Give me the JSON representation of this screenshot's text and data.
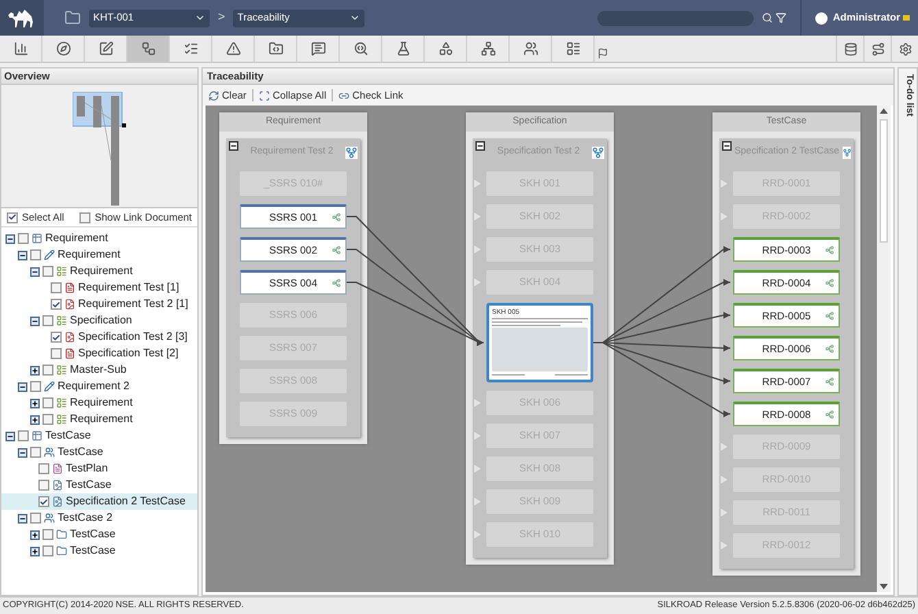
{
  "topbar": {
    "project": "KHT-001",
    "separator": ">",
    "view": "Traceability",
    "user": "Administrator"
  },
  "toolbar": [
    {
      "selected": false
    },
    {
      "selected": false
    },
    {
      "selected": false
    },
    {
      "selected": true
    },
    {
      "selected": false
    },
    {
      "selected": false
    },
    {
      "selected": false
    },
    {
      "selected": false
    },
    {
      "selected": false
    },
    {
      "selected": false
    },
    {
      "selected": false
    },
    {
      "selected": false
    },
    {
      "selected": false
    },
    {
      "selected": false
    }
  ],
  "left_panel": {
    "overview_title": "Overview",
    "select_all": {
      "label": "Select All",
      "checked": true
    },
    "show_link_document": {
      "label": "Show Link Document",
      "checked": false
    },
    "tree": [
      {
        "label": "Requirement",
        "kind": "category",
        "checked": false,
        "expanded": true,
        "selected": false,
        "children": [
          {
            "label": "Requirement",
            "kind": "pencil",
            "checked": false,
            "expanded": true,
            "selected": false,
            "children": [
              {
                "label": "Requirement",
                "kind": "grid",
                "checked": false,
                "expanded": true,
                "selected": false,
                "children": [
                  {
                    "label": "Requirement Test [1]",
                    "kind": "pdf",
                    "checked": false,
                    "selected": false
                  },
                  {
                    "label": "Requirement Test 2 [1]",
                    "kind": "pdf-doc",
                    "checked": true,
                    "selected": false
                  }
                ]
              },
              {
                "label": "Specification",
                "kind": "grid",
                "checked": false,
                "expanded": true,
                "selected": false,
                "children": [
                  {
                    "label": "Specification Test 2 [3]",
                    "kind": "pdf-doc",
                    "checked": true,
                    "selected": false
                  },
                  {
                    "label": "Specification Test [2]",
                    "kind": "pdf",
                    "checked": false,
                    "selected": false
                  }
                ]
              },
              {
                "label": "Master-Sub",
                "kind": "grid",
                "checked": false,
                "expanded": false,
                "selected": false
              }
            ]
          },
          {
            "label": "Requirement 2",
            "kind": "pencil",
            "checked": false,
            "expanded": true,
            "selected": false,
            "children": [
              {
                "label": "Requirement",
                "kind": "grid",
                "checked": false,
                "expanded": false,
                "selected": false
              },
              {
                "label": "Requirement",
                "kind": "grid",
                "checked": false,
                "expanded": false,
                "selected": false
              }
            ]
          }
        ]
      },
      {
        "label": "TestCase",
        "kind": "category",
        "checked": false,
        "expanded": true,
        "selected": false,
        "children": [
          {
            "label": "TestCase",
            "kind": "people",
            "checked": false,
            "expanded": true,
            "selected": false,
            "children": [
              {
                "label": "TestPlan",
                "kind": "plan",
                "checked": false,
                "selected": false
              },
              {
                "label": "TestCase",
                "kind": "testdoc",
                "checked": false,
                "selected": false
              },
              {
                "label": "Specification 2 TestCase",
                "kind": "testdoc",
                "checked": true,
                "selected": true
              }
            ]
          },
          {
            "label": "TestCase 2",
            "kind": "people",
            "checked": false,
            "expanded": true,
            "selected": false,
            "children": [
              {
                "label": "TestCase",
                "kind": "folder",
                "checked": false,
                "expanded": false,
                "selected": false
              },
              {
                "label": "TestCase",
                "kind": "folder",
                "checked": false,
                "expanded": false,
                "selected": false
              }
            ]
          }
        ]
      }
    ]
  },
  "traceability": {
    "title": "Traceability",
    "actions": [
      {
        "label": "Clear"
      },
      {
        "label": "Collapse All"
      },
      {
        "label": "Check Link"
      }
    ],
    "columns": [
      {
        "header": "Requirement",
        "group": "Requirement Test 2",
        "items": [
          {
            "kind": "item",
            "label": "_SSRS 010#",
            "linked": false
          },
          {
            "kind": "item",
            "label": "SSRS 001",
            "linked": true
          },
          {
            "kind": "item",
            "label": "SSRS 002",
            "linked": true
          },
          {
            "kind": "item",
            "label": "SSRS 004",
            "linked": true
          },
          {
            "kind": "item",
            "label": "SSRS 006",
            "linked": false
          },
          {
            "kind": "item",
            "label": "SSRS 007",
            "linked": false
          },
          {
            "kind": "item",
            "label": "SSRS 008",
            "linked": false
          },
          {
            "kind": "item",
            "label": "SSRS 009",
            "linked": false
          }
        ]
      },
      {
        "header": "Specification",
        "group": "Specification Test 2",
        "items": [
          {
            "kind": "item",
            "label": "SKH 001",
            "linked": false
          },
          {
            "kind": "item",
            "label": "SKH 002",
            "linked": false
          },
          {
            "kind": "item",
            "label": "SKH 003",
            "linked": false
          },
          {
            "kind": "item",
            "label": "SKH 004",
            "linked": false
          },
          {
            "kind": "preview",
            "label": "SKH 005",
            "linked": true
          },
          {
            "kind": "item",
            "label": "SKH 006",
            "linked": false
          },
          {
            "kind": "item",
            "label": "SKH 007",
            "linked": false
          },
          {
            "kind": "item",
            "label": "SKH 008",
            "linked": false
          },
          {
            "kind": "item",
            "label": "SKH 009",
            "linked": false
          },
          {
            "kind": "item",
            "label": "SKH 010",
            "linked": false
          }
        ]
      },
      {
        "header": "TestCase",
        "group": "Specification 2 TestCase",
        "items": [
          {
            "kind": "item",
            "label": "RRD-0001",
            "linked": false
          },
          {
            "kind": "item",
            "label": "RRD-0002",
            "linked": false
          },
          {
            "kind": "item",
            "label": "RRD-0003",
            "linked": true
          },
          {
            "kind": "item",
            "label": "RRD-0004",
            "linked": true
          },
          {
            "kind": "item",
            "label": "RRD-0005",
            "linked": true
          },
          {
            "kind": "item",
            "label": "RRD-0006",
            "linked": true
          },
          {
            "kind": "item",
            "label": "RRD-0007",
            "linked": true
          },
          {
            "kind": "item",
            "label": "RRD-0008",
            "linked": true
          },
          {
            "kind": "item",
            "label": "RRD-0009",
            "linked": false
          },
          {
            "kind": "item",
            "label": "RRD-0010",
            "linked": false
          },
          {
            "kind": "item",
            "label": "RRD-0011",
            "linked": false
          },
          {
            "kind": "item",
            "label": "RRD-0012",
            "linked": false
          }
        ]
      }
    ]
  },
  "todo": {
    "label": "To-do list"
  },
  "footer": {
    "copyright": "COPYRIGHT(C) 2014-2020 NSE. ALL RIGHTS RESERVED.",
    "version": "SILKROAD Release Version 5.2.5.8306 (2020-06-02 d6b462d25)"
  }
}
